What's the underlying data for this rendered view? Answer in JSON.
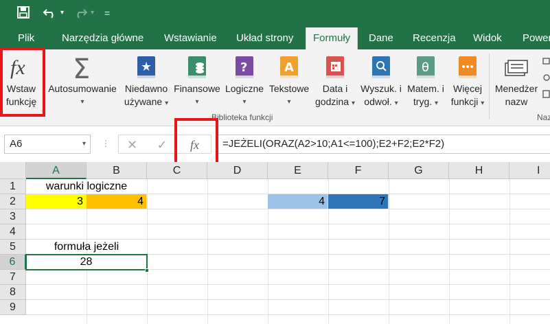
{
  "qat": {
    "undo_caret": "▾",
    "redo_caret": "▾",
    "customize": "="
  },
  "tabs": [
    "Plik",
    "Narzędzia główne",
    "Wstawianie",
    "Układ strony",
    "Formuły",
    "Dane",
    "Recenzja",
    "Widok",
    "Power"
  ],
  "active_tab": "Formuły",
  "ribbon": {
    "insert_function": {
      "line1": "Wstaw",
      "line2": "funkcję"
    },
    "autosum": {
      "line1": "Autosumowanie"
    },
    "recent": {
      "line1": "Niedawno",
      "line2": "używane"
    },
    "financial": {
      "line1": "Finansowe"
    },
    "logical": {
      "line1": "Logiczne"
    },
    "text": {
      "line1": "Tekstowe"
    },
    "datetime": {
      "line1": "Data i",
      "line2": "godzina"
    },
    "lookup": {
      "line1": "Wyszuk. i",
      "line2": "odwoł."
    },
    "math": {
      "line1": "Matem. i",
      "line2": "tryg."
    },
    "more": {
      "line1": "Więcej",
      "line2": "funkcji"
    },
    "name_manager": {
      "line1": "Menedżer",
      "line2": "nazw"
    },
    "group_label": "Biblioteka funkcji",
    "next_group_label": "Naz"
  },
  "formula_bar": {
    "name_box": "A6",
    "cancel": "✕",
    "enter": "✓",
    "fx": "fx",
    "formula": "=JEŻELI(ORAZ(A2>10;A1<=100);E2+F2;E2*F2)"
  },
  "columns": [
    "A",
    "B",
    "C",
    "D",
    "E",
    "F",
    "G",
    "H",
    "I"
  ],
  "rows": [
    "1",
    "2",
    "3",
    "4",
    "5",
    "6",
    "7",
    "8",
    "9"
  ],
  "cells": {
    "A1": "warunki logiczne",
    "A2": "3",
    "B2": "4",
    "E2": "4",
    "F2": "7",
    "A5": "formuła jeżeli",
    "A6": "28"
  },
  "colors": {
    "excel_green": "#217346",
    "highlight_red": "#e8151b",
    "yellow": "#ffff00",
    "orange": "#ffc000",
    "light_blue": "#9dc3e6",
    "dark_blue": "#2e75b6"
  }
}
